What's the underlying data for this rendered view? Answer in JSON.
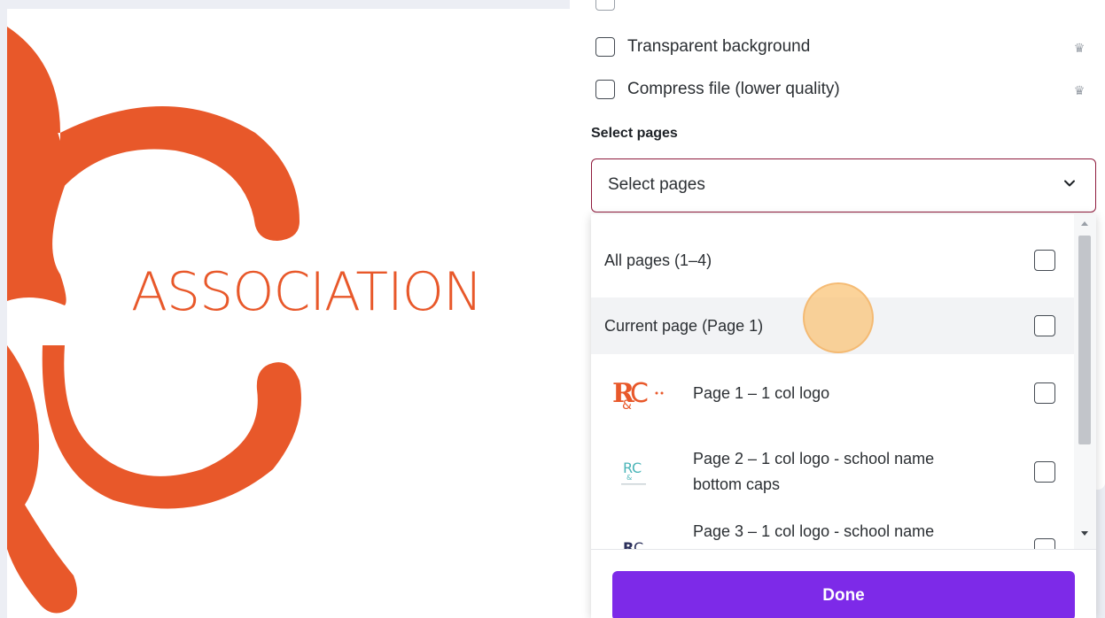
{
  "canvas": {
    "logo_text": "ASSOCIATION",
    "accent_color": "#e8582a"
  },
  "panel": {
    "options": [
      {
        "label": "Transparent background",
        "checked": false,
        "premium_icon": "crown-icon"
      },
      {
        "label": "Compress file (lower quality)",
        "checked": false,
        "premium_icon": "crown-icon"
      }
    ],
    "select_pages_label": "Select pages",
    "select_pages_value": "Select pages",
    "dropdown": {
      "items": [
        {
          "label": "All pages (1–4)",
          "checked": false
        },
        {
          "label": "Current page (Page 1)",
          "checked": false
        },
        {
          "label": "Page 1 – 1 col logo",
          "checked": false
        },
        {
          "label_line1": "Page 2 – 1 col logo - school name",
          "label_line2": "bottom caps",
          "checked": false
        },
        {
          "label": "Page 3 – 1 col logo - school name",
          "checked": false
        }
      ],
      "thumbnail_text": "R&C",
      "done_label": "Done"
    }
  },
  "colors": {
    "primary_button": "#7d2ae8",
    "select_border": "#8f1b3d",
    "logo_orange": "#e8582a",
    "thumb_teal": "#4bb5b8",
    "thumb_navy": "#2a2f5a"
  }
}
